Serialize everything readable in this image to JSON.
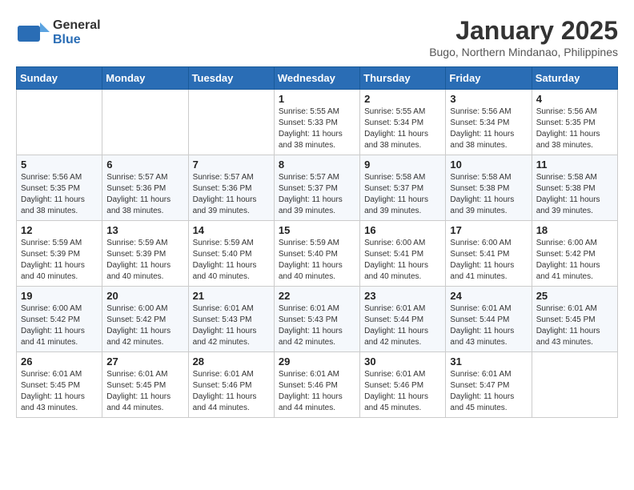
{
  "header": {
    "logo_general": "General",
    "logo_blue": "Blue",
    "month_title": "January 2025",
    "location": "Bugo, Northern Mindanao, Philippines"
  },
  "days_of_week": [
    "Sunday",
    "Monday",
    "Tuesday",
    "Wednesday",
    "Thursday",
    "Friday",
    "Saturday"
  ],
  "weeks": [
    [
      {
        "day": "",
        "sunrise": "",
        "sunset": "",
        "daylight": ""
      },
      {
        "day": "",
        "sunrise": "",
        "sunset": "",
        "daylight": ""
      },
      {
        "day": "",
        "sunrise": "",
        "sunset": "",
        "daylight": ""
      },
      {
        "day": "1",
        "sunrise": "Sunrise: 5:55 AM",
        "sunset": "Sunset: 5:33 PM",
        "daylight": "Daylight: 11 hours and 38 minutes."
      },
      {
        "day": "2",
        "sunrise": "Sunrise: 5:55 AM",
        "sunset": "Sunset: 5:34 PM",
        "daylight": "Daylight: 11 hours and 38 minutes."
      },
      {
        "day": "3",
        "sunrise": "Sunrise: 5:56 AM",
        "sunset": "Sunset: 5:34 PM",
        "daylight": "Daylight: 11 hours and 38 minutes."
      },
      {
        "day": "4",
        "sunrise": "Sunrise: 5:56 AM",
        "sunset": "Sunset: 5:35 PM",
        "daylight": "Daylight: 11 hours and 38 minutes."
      }
    ],
    [
      {
        "day": "5",
        "sunrise": "Sunrise: 5:56 AM",
        "sunset": "Sunset: 5:35 PM",
        "daylight": "Daylight: 11 hours and 38 minutes."
      },
      {
        "day": "6",
        "sunrise": "Sunrise: 5:57 AM",
        "sunset": "Sunset: 5:36 PM",
        "daylight": "Daylight: 11 hours and 38 minutes."
      },
      {
        "day": "7",
        "sunrise": "Sunrise: 5:57 AM",
        "sunset": "Sunset: 5:36 PM",
        "daylight": "Daylight: 11 hours and 39 minutes."
      },
      {
        "day": "8",
        "sunrise": "Sunrise: 5:57 AM",
        "sunset": "Sunset: 5:37 PM",
        "daylight": "Daylight: 11 hours and 39 minutes."
      },
      {
        "day": "9",
        "sunrise": "Sunrise: 5:58 AM",
        "sunset": "Sunset: 5:37 PM",
        "daylight": "Daylight: 11 hours and 39 minutes."
      },
      {
        "day": "10",
        "sunrise": "Sunrise: 5:58 AM",
        "sunset": "Sunset: 5:38 PM",
        "daylight": "Daylight: 11 hours and 39 minutes."
      },
      {
        "day": "11",
        "sunrise": "Sunrise: 5:58 AM",
        "sunset": "Sunset: 5:38 PM",
        "daylight": "Daylight: 11 hours and 39 minutes."
      }
    ],
    [
      {
        "day": "12",
        "sunrise": "Sunrise: 5:59 AM",
        "sunset": "Sunset: 5:39 PM",
        "daylight": "Daylight: 11 hours and 40 minutes."
      },
      {
        "day": "13",
        "sunrise": "Sunrise: 5:59 AM",
        "sunset": "Sunset: 5:39 PM",
        "daylight": "Daylight: 11 hours and 40 minutes."
      },
      {
        "day": "14",
        "sunrise": "Sunrise: 5:59 AM",
        "sunset": "Sunset: 5:40 PM",
        "daylight": "Daylight: 11 hours and 40 minutes."
      },
      {
        "day": "15",
        "sunrise": "Sunrise: 5:59 AM",
        "sunset": "Sunset: 5:40 PM",
        "daylight": "Daylight: 11 hours and 40 minutes."
      },
      {
        "day": "16",
        "sunrise": "Sunrise: 6:00 AM",
        "sunset": "Sunset: 5:41 PM",
        "daylight": "Daylight: 11 hours and 40 minutes."
      },
      {
        "day": "17",
        "sunrise": "Sunrise: 6:00 AM",
        "sunset": "Sunset: 5:41 PM",
        "daylight": "Daylight: 11 hours and 41 minutes."
      },
      {
        "day": "18",
        "sunrise": "Sunrise: 6:00 AM",
        "sunset": "Sunset: 5:42 PM",
        "daylight": "Daylight: 11 hours and 41 minutes."
      }
    ],
    [
      {
        "day": "19",
        "sunrise": "Sunrise: 6:00 AM",
        "sunset": "Sunset: 5:42 PM",
        "daylight": "Daylight: 11 hours and 41 minutes."
      },
      {
        "day": "20",
        "sunrise": "Sunrise: 6:00 AM",
        "sunset": "Sunset: 5:42 PM",
        "daylight": "Daylight: 11 hours and 42 minutes."
      },
      {
        "day": "21",
        "sunrise": "Sunrise: 6:01 AM",
        "sunset": "Sunset: 5:43 PM",
        "daylight": "Daylight: 11 hours and 42 minutes."
      },
      {
        "day": "22",
        "sunrise": "Sunrise: 6:01 AM",
        "sunset": "Sunset: 5:43 PM",
        "daylight": "Daylight: 11 hours and 42 minutes."
      },
      {
        "day": "23",
        "sunrise": "Sunrise: 6:01 AM",
        "sunset": "Sunset: 5:44 PM",
        "daylight": "Daylight: 11 hours and 42 minutes."
      },
      {
        "day": "24",
        "sunrise": "Sunrise: 6:01 AM",
        "sunset": "Sunset: 5:44 PM",
        "daylight": "Daylight: 11 hours and 43 minutes."
      },
      {
        "day": "25",
        "sunrise": "Sunrise: 6:01 AM",
        "sunset": "Sunset: 5:45 PM",
        "daylight": "Daylight: 11 hours and 43 minutes."
      }
    ],
    [
      {
        "day": "26",
        "sunrise": "Sunrise: 6:01 AM",
        "sunset": "Sunset: 5:45 PM",
        "daylight": "Daylight: 11 hours and 43 minutes."
      },
      {
        "day": "27",
        "sunrise": "Sunrise: 6:01 AM",
        "sunset": "Sunset: 5:45 PM",
        "daylight": "Daylight: 11 hours and 44 minutes."
      },
      {
        "day": "28",
        "sunrise": "Sunrise: 6:01 AM",
        "sunset": "Sunset: 5:46 PM",
        "daylight": "Daylight: 11 hours and 44 minutes."
      },
      {
        "day": "29",
        "sunrise": "Sunrise: 6:01 AM",
        "sunset": "Sunset: 5:46 PM",
        "daylight": "Daylight: 11 hours and 44 minutes."
      },
      {
        "day": "30",
        "sunrise": "Sunrise: 6:01 AM",
        "sunset": "Sunset: 5:46 PM",
        "daylight": "Daylight: 11 hours and 45 minutes."
      },
      {
        "day": "31",
        "sunrise": "Sunrise: 6:01 AM",
        "sunset": "Sunset: 5:47 PM",
        "daylight": "Daylight: 11 hours and 45 minutes."
      },
      {
        "day": "",
        "sunrise": "",
        "sunset": "",
        "daylight": ""
      }
    ]
  ]
}
